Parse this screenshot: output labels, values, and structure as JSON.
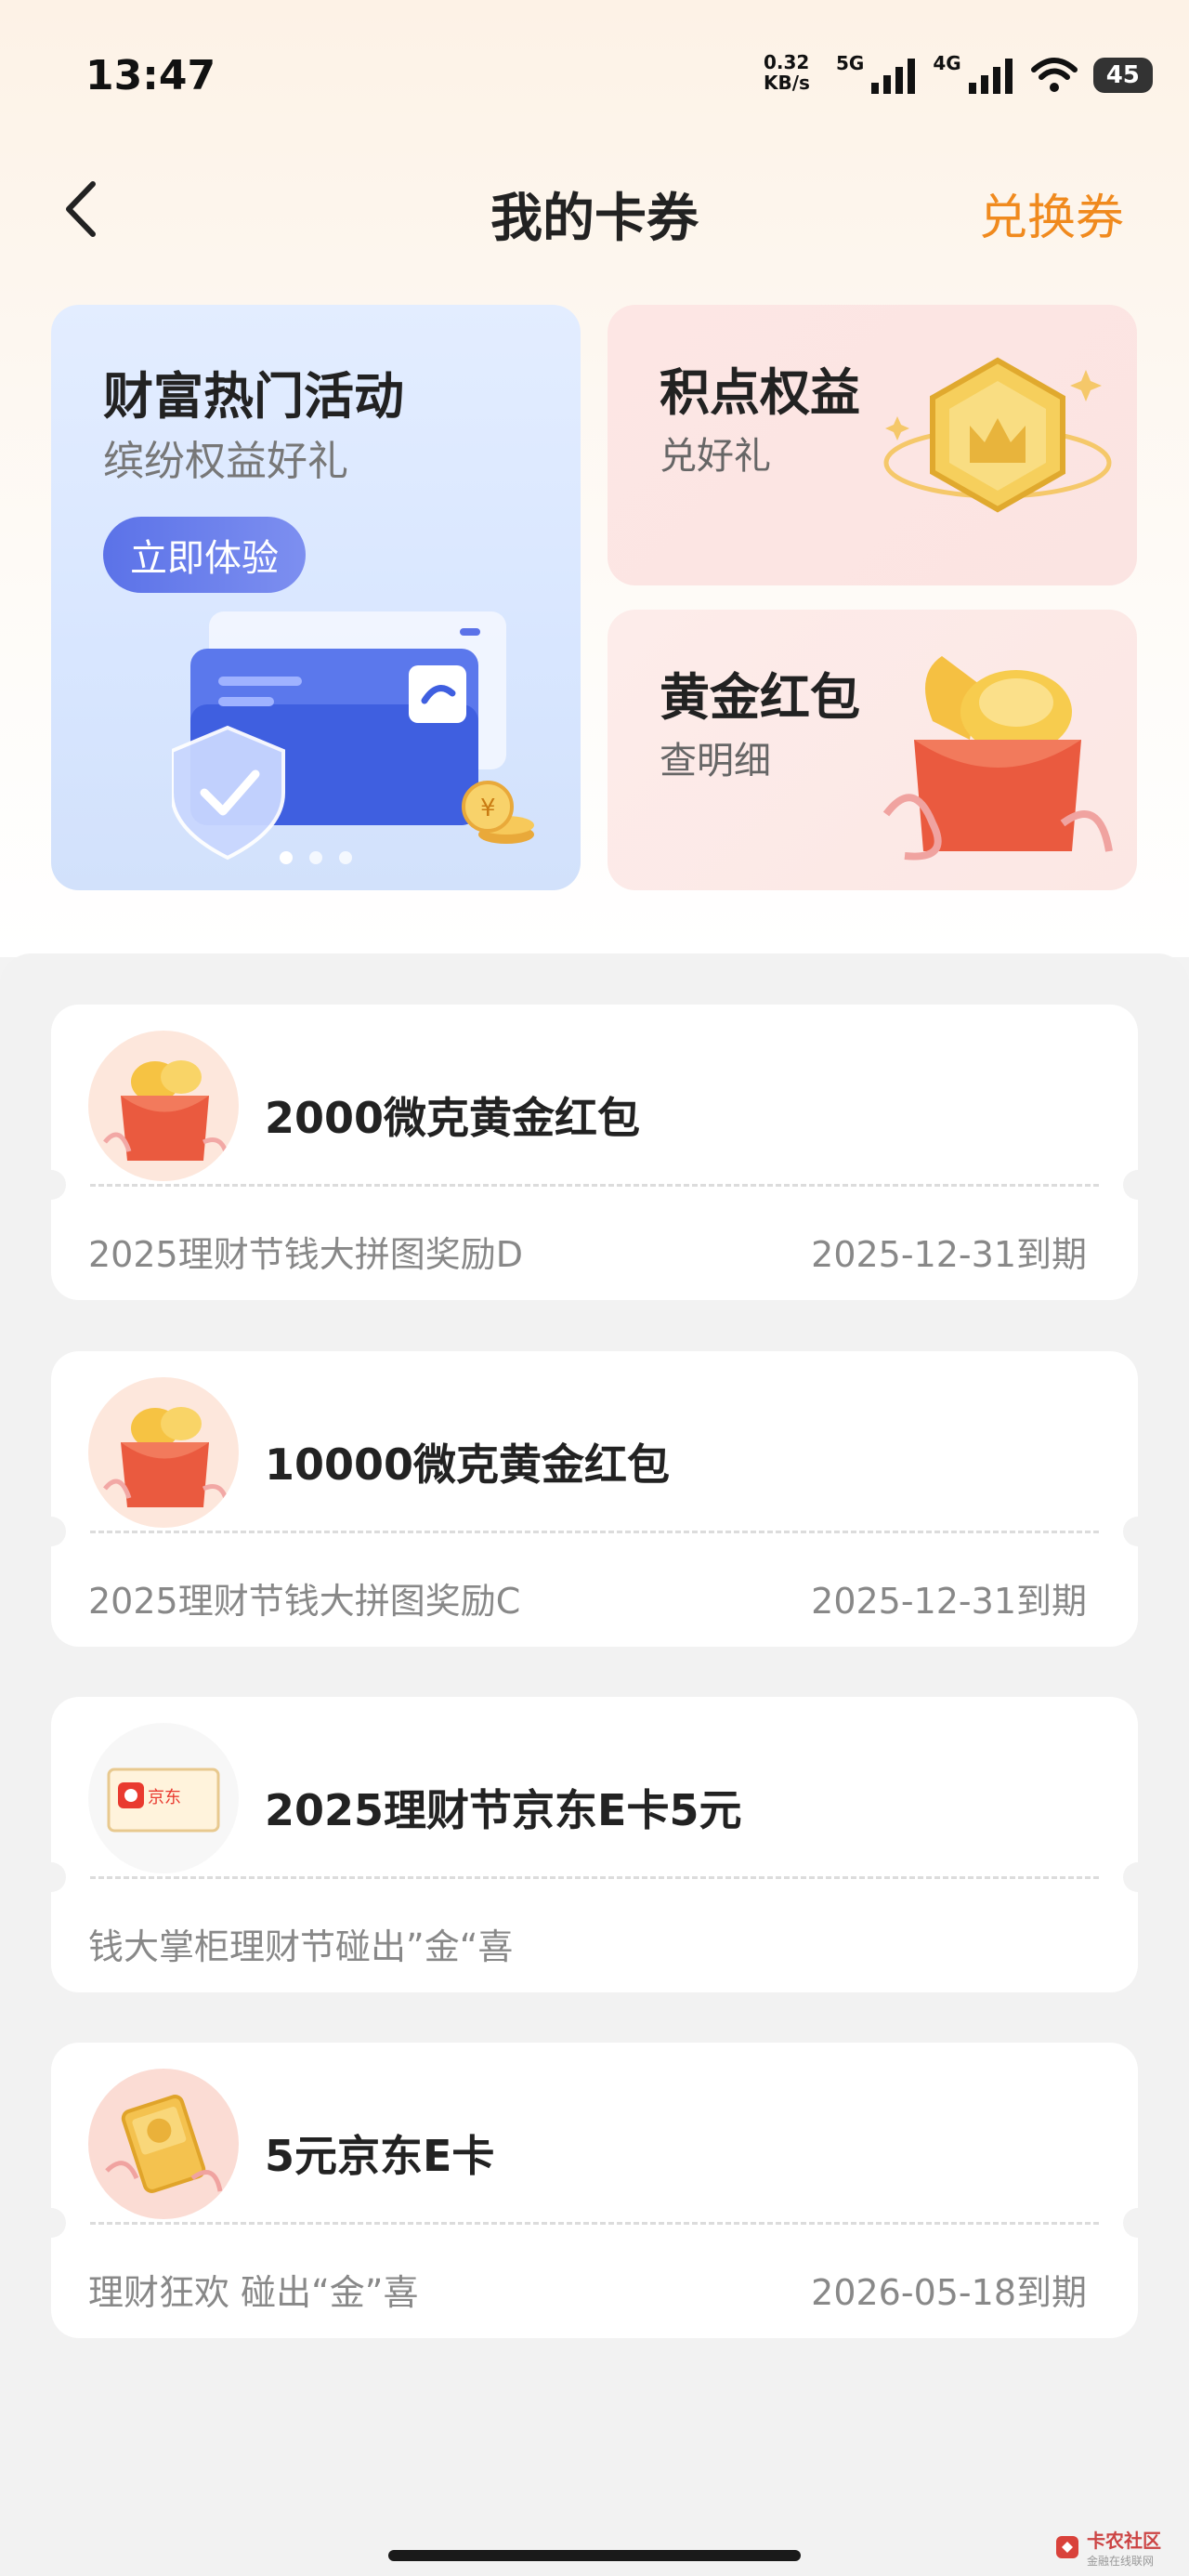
{
  "status_bar": {
    "time": "13:47",
    "net_speed_value": "0.32",
    "net_speed_unit": "KB/s",
    "sim1_label": "5G",
    "sim2_label": "4G",
    "battery": "45"
  },
  "header": {
    "title": "我的卡券",
    "action": "兑换券"
  },
  "promo": {
    "main": {
      "title": "财富热门活动",
      "subtitle": "缤纷权益好礼",
      "button": "立即体验"
    },
    "points": {
      "title": "积点权益",
      "subtitle": "兑好礼"
    },
    "gold": {
      "title": "黄金红包",
      "subtitle": "查明细"
    }
  },
  "vouchers": [
    {
      "name": "2000微克黄金红包",
      "desc": "2025理财节钱大拼图奖励D",
      "expire": "2025-12-31到期",
      "icon": "gold-red-envelope-icon"
    },
    {
      "name": "10000微克黄金红包",
      "desc": "2025理财节钱大拼图奖励C",
      "expire": "2025-12-31到期",
      "icon": "gold-red-envelope-icon"
    },
    {
      "name": "2025理财节京东E卡5元",
      "desc": "钱大掌柜理财节碰出”金“喜",
      "expire": "",
      "icon": "jd-card-icon",
      "jd_text": "京东"
    },
    {
      "name": "5元京东E卡",
      "desc": "理财狂欢 碰出“金”喜",
      "expire": "2026-05-18到期",
      "icon": "gold-card-icon"
    }
  ],
  "watermark": {
    "name": "卡农社区",
    "tagline": "金融在线联网"
  },
  "colors": {
    "accent": "#f08a1e",
    "button": "#5b72e8",
    "red_envelope": "#e8553a"
  }
}
